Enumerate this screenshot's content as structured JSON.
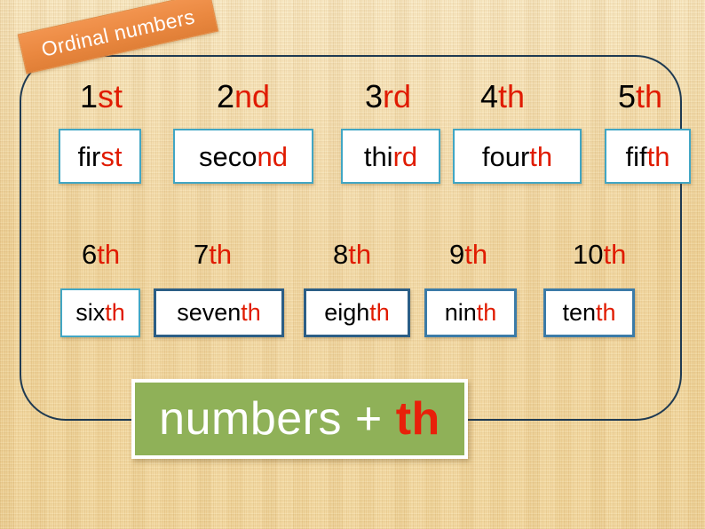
{
  "slide": {
    "title_tag": "Ordinal numbers",
    "background_color": "#f2d79c",
    "frame_color": "#1f3a52",
    "accent_red": "#e01b00",
    "tag_orange": "#ea8840",
    "banner_green": "#8fb158"
  },
  "rows": [
    {
      "row_id": "row-1",
      "items": [
        {
          "numeral_base": "1",
          "numeral_suffix": "st",
          "word_base": "fir",
          "word_suffix": "st",
          "border_style": "teal"
        },
        {
          "numeral_base": "2",
          "numeral_suffix": "nd",
          "word_base": "seco",
          "word_suffix": "nd",
          "border_style": "teal"
        },
        {
          "numeral_base": "3",
          "numeral_suffix": "rd",
          "word_base": "thi",
          "word_suffix": "rd",
          "border_style": "teal"
        },
        {
          "numeral_base": "4",
          "numeral_suffix": "th",
          "word_base": "four",
          "word_suffix": "th",
          "border_style": "teal"
        },
        {
          "numeral_base": "5",
          "numeral_suffix": "th",
          "word_base": "fif",
          "word_suffix": "th",
          "border_style": "teal"
        }
      ]
    },
    {
      "row_id": "row-2",
      "items": [
        {
          "numeral_base": "6",
          "numeral_suffix": "th",
          "word_base": "six",
          "word_suffix": "th",
          "border_style": "teal"
        },
        {
          "numeral_base": "7",
          "numeral_suffix": "th",
          "word_base": "seven",
          "word_suffix": "th",
          "border_style": "navy"
        },
        {
          "numeral_base": "8",
          "numeral_suffix": "th",
          "word_base": "eigh",
          "word_suffix": "th",
          "border_style": "navy"
        },
        {
          "numeral_base": "9",
          "numeral_suffix": "th",
          "word_base": "nin",
          "word_suffix": "th",
          "border_style": "steel"
        },
        {
          "numeral_base": "10",
          "numeral_suffix": "th",
          "word_base": "ten",
          "word_suffix": "th",
          "border_style": "steel"
        }
      ]
    }
  ],
  "rule_banner": {
    "base": "numbers + ",
    "suffix": "th"
  }
}
